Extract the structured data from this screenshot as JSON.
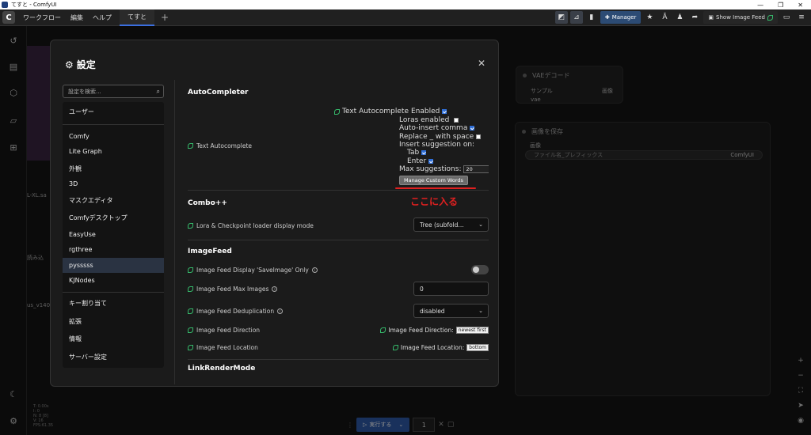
{
  "window": {
    "title": "てすと - ComfyUI",
    "controls": [
      "—",
      "❐",
      "✕"
    ]
  },
  "menubar": {
    "logo": "C",
    "items": [
      "ワークフロー",
      "編集",
      "ヘルプ"
    ],
    "tab": "てすと",
    "plus": "+",
    "manager_label": "Manager",
    "show_feed_label": "Show Image Feed"
  },
  "canvas": {
    "vae_node_title": "VAEデコード",
    "vae_in_samples": "サンプル",
    "vae_in_vae": "vae",
    "vae_out_image": "画像",
    "save_node_title": "画像を保存",
    "save_in_images": "画像",
    "save_prefix_label": "ファイル名_プレフィックス",
    "save_prefix_value": "ComfyUI",
    "left_fragments": [
      "L-XL.sa",
      "読み込",
      "us_v140"
    ],
    "stats": [
      "T: 0.00s",
      "I: 0",
      "N: 8 [8]",
      "V: 16",
      "FPS:61.35"
    ]
  },
  "runbar": {
    "run_label": "実行する",
    "count": "1"
  },
  "dialog": {
    "title": "設定",
    "close": "✕",
    "search_placeholder": "設定を検索...",
    "categories_top": [
      "ユーザー"
    ],
    "categories_mid": [
      "Comfy",
      "Lite Graph",
      "外観",
      "3D",
      "マスクエディタ",
      "Comfyデスクトップ",
      "EasyUse",
      "rgthree",
      "pysssss",
      "KJNodes"
    ],
    "categories_bot": [
      "キー割り当て",
      "拡張",
      "情報",
      "サーバー設定"
    ],
    "selected_category": "pysssss"
  },
  "panel": {
    "autocompleter": {
      "heading": "AutoCompleter",
      "setting_label": "Text Autocomplete",
      "inline_label": "Text Autocomplete",
      "enabled_label": "Enabled",
      "loras_label": "Loras enabled",
      "comma_label": "Auto-insert comma",
      "replace_label": "Replace _ with space",
      "insert_label": "Insert suggestion on:",
      "tab_label": "Tab",
      "enter_label": "Enter",
      "max_label": "Max suggestions:",
      "max_value": "20",
      "manage_label": "Manage Custom Words"
    },
    "annotation": "ここに入る",
    "combo": {
      "heading": "Combo++",
      "lora_label": "Lora & Checkpoint loader display mode",
      "lora_value": "Tree (subfold..."
    },
    "imagefeed": {
      "heading": "ImageFeed",
      "display_label": "Image Feed Display 'SaveImage' Only",
      "max_images_label": "Image Feed Max Images",
      "max_images_value": "0",
      "dedup_label": "Image Feed Deduplication",
      "dedup_value": "disabled",
      "direction_label": "Image Feed Direction",
      "direction_inline": "Image Feed Direction:",
      "direction_value": "newest first",
      "location_label": "Image Feed Location",
      "location_inline": "Image Feed Location:",
      "location_value": "bottom"
    },
    "linkrender": {
      "heading": "LinkRenderMode"
    }
  },
  "colors": {
    "accent_green": "#35b86a",
    "annotation_red": "#e02020",
    "selected_bg": "#2a3342",
    "run_blue": "#2e5aa8"
  }
}
